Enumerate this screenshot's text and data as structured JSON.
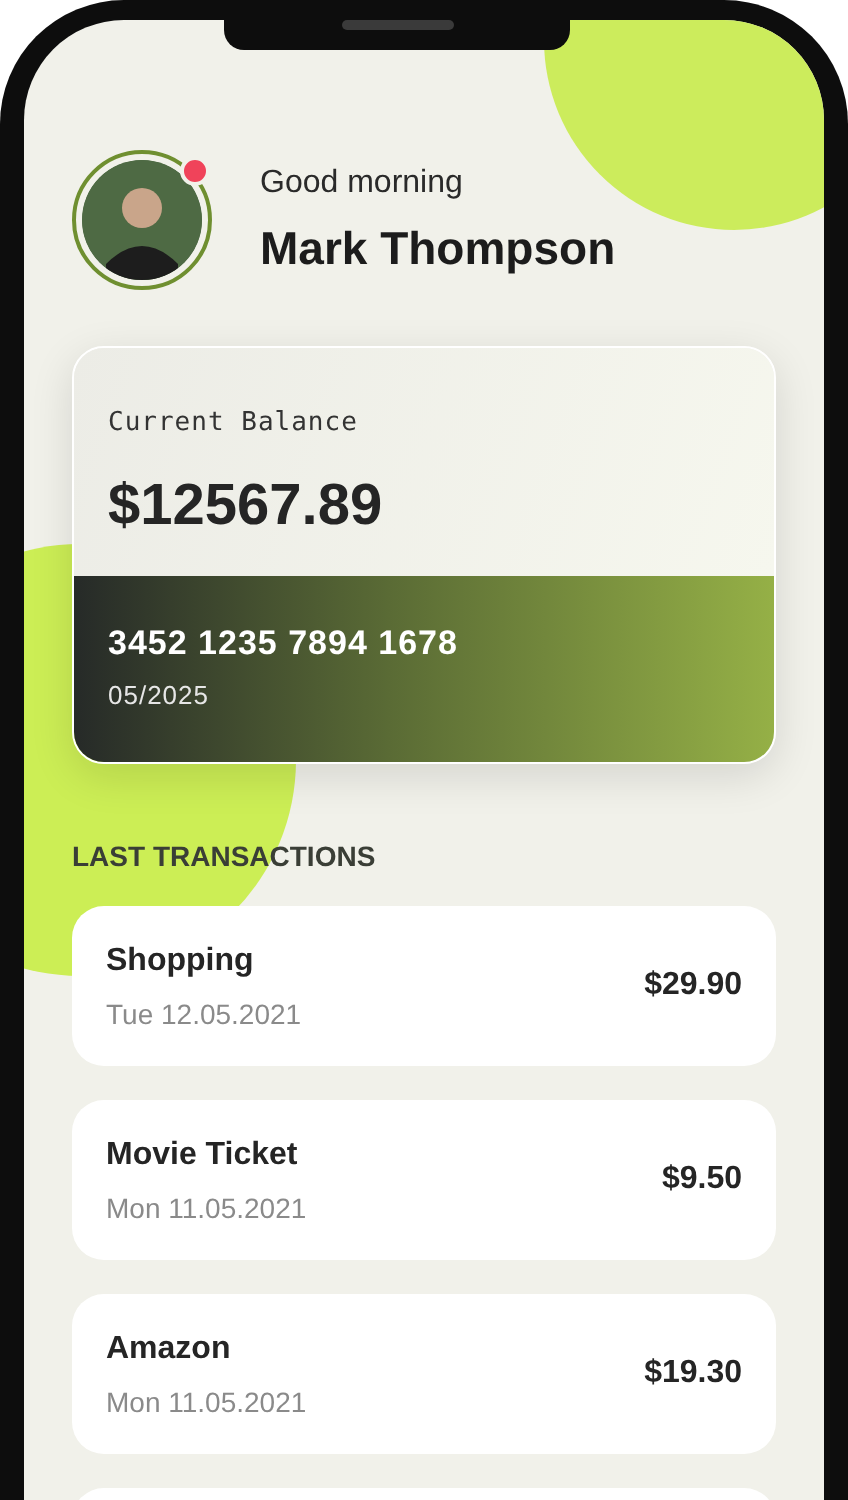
{
  "header": {
    "greeting": "Good morning",
    "name": "Mark Thompson",
    "notification": true
  },
  "balance_card": {
    "label": "Current Balance",
    "amount": "$12567.89",
    "card_number": "3452 1235 7894 1678",
    "expiry": "05/2025"
  },
  "transactions": {
    "title": "LAST TRANSACTIONS",
    "items": [
      {
        "name": "Shopping",
        "date": "Tue 12.05.2021",
        "amount": "$29.90"
      },
      {
        "name": "Movie Ticket",
        "date": "Mon 11.05.2021",
        "amount": "$9.50"
      },
      {
        "name": "Amazon",
        "date": "Mon 11.05.2021",
        "amount": "$19.30"
      }
    ]
  }
}
